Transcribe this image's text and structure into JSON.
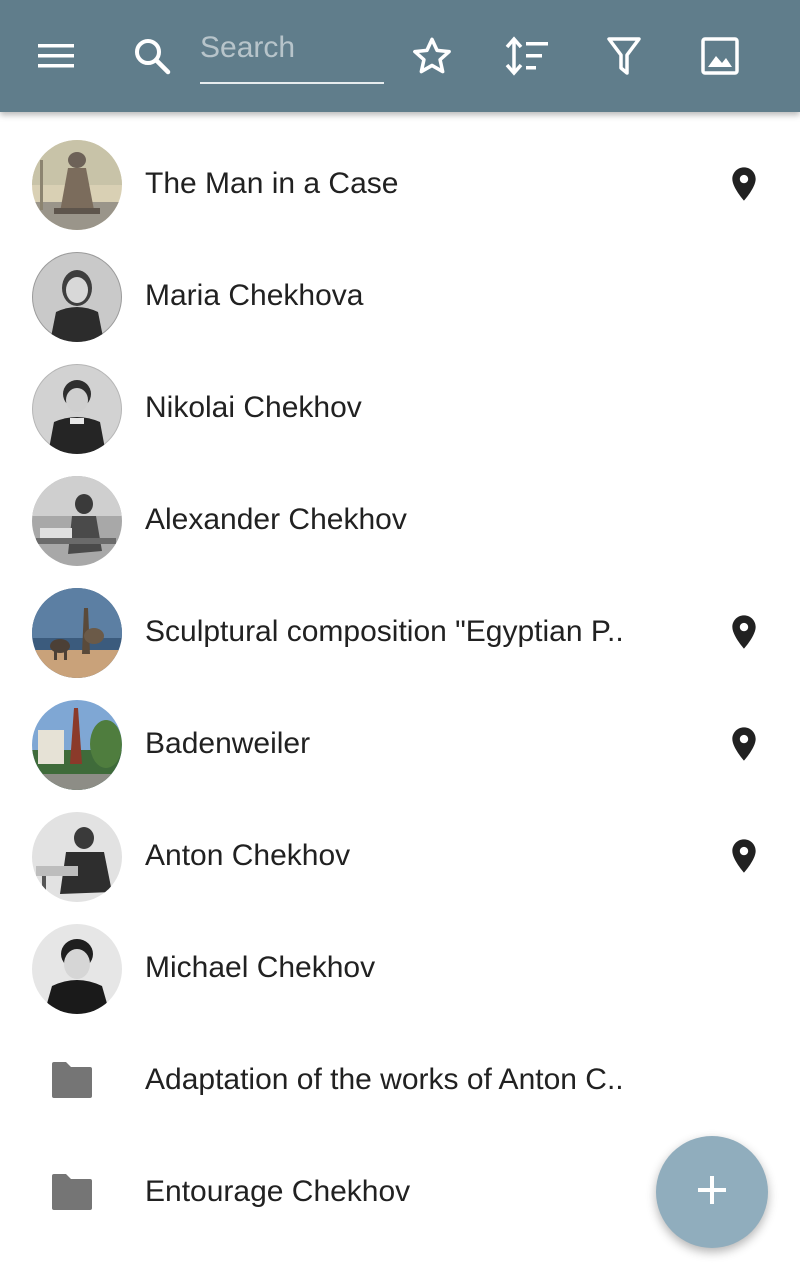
{
  "toolbar": {
    "background": "#607d8b",
    "search_placeholder": "Search",
    "search_value": "",
    "icons": [
      "menu-icon",
      "search-icon",
      "star-outline-icon",
      "sort-icon",
      "filter-icon",
      "image-icon"
    ]
  },
  "items": [
    {
      "label": "The Man in a Case",
      "kind": "photo",
      "has_location": true
    },
    {
      "label": "Maria Chekhova",
      "kind": "photo",
      "has_location": false
    },
    {
      "label": "Nikolai Chekhov",
      "kind": "photo",
      "has_location": false
    },
    {
      "label": "Alexander Chekhov",
      "kind": "photo",
      "has_location": false
    },
    {
      "label": "Sculptural composition \"Egyptian P..",
      "kind": "photo",
      "has_location": true
    },
    {
      "label": "Badenweiler",
      "kind": "photo",
      "has_location": true
    },
    {
      "label": "Anton Chekhov",
      "kind": "photo",
      "has_location": true
    },
    {
      "label": "Michael Chekhov",
      "kind": "photo",
      "has_location": false
    },
    {
      "label": "Adaptation of the works of Anton C..",
      "kind": "folder",
      "has_location": false
    },
    {
      "label": "Entourage Chekhov",
      "kind": "folder",
      "has_location": false
    }
  ],
  "fab": {
    "icon": "plus-icon",
    "color": "#90adbd"
  }
}
